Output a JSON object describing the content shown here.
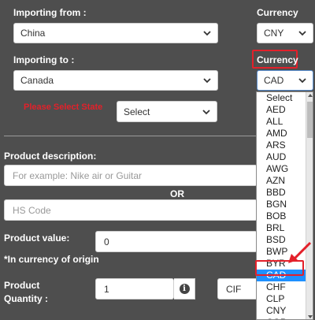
{
  "import_from": {
    "label": "Importing from :",
    "country": "China",
    "currency_label": "Currency",
    "currency": "CNY"
  },
  "import_to": {
    "label": "Importing to :",
    "country": "Canada",
    "currency_label": "Currency",
    "currency": "CAD"
  },
  "state": {
    "warning": "Please Select State",
    "placeholder": "Select"
  },
  "product": {
    "description_label": "Product description:",
    "description_placeholder": "For example: Nike air or Guitar",
    "or_label": "OR",
    "hs_placeholder": "HS Code",
    "value_label": "Product value:",
    "value": "0",
    "currency_note": "*In currency of origin",
    "quantity_label_1": "Product",
    "quantity_label_2": "Quantity :",
    "quantity": "1",
    "incoterm": "CIF"
  },
  "currency_dropdown": {
    "options": [
      "Select",
      "AED",
      "ALL",
      "AMD",
      "ARS",
      "AUD",
      "AWG",
      "AZN",
      "BBD",
      "BGN",
      "BOB",
      "BRL",
      "BSD",
      "BWP",
      "BYR",
      "CAD",
      "CHF",
      "CLP",
      "CNY",
      "COP"
    ],
    "selected": "CAD"
  },
  "colors": {
    "highlight": "#1e90ff",
    "annotation_red": "#e3202a"
  }
}
